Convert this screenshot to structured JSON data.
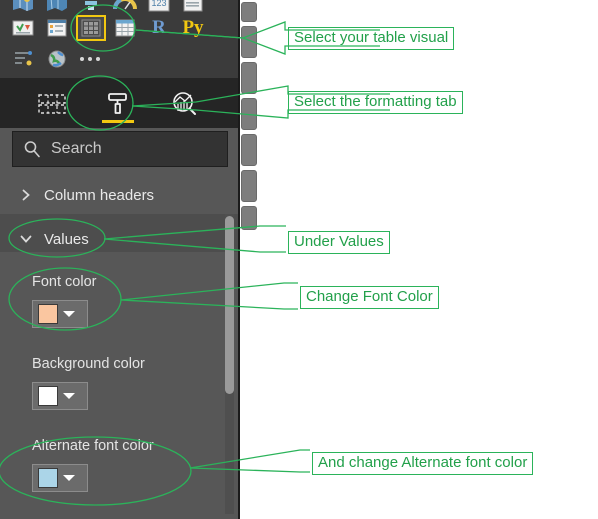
{
  "pane": {
    "visual_gallery": {
      "name": "visualizations-gallery",
      "row0": [
        {
          "icon": "map-filled-icon",
          "label": "Filled map"
        },
        {
          "icon": "globe-map-icon",
          "label": "Map"
        },
        {
          "icon": "funnel-icon",
          "label": "Funnel"
        },
        {
          "icon": "gauge-icon",
          "label": "Gauge"
        },
        {
          "icon": "card-number-icon",
          "label": "Card"
        },
        {
          "icon": "multi-row-card-icon",
          "label": "Multi-row card"
        }
      ],
      "row1": [
        {
          "icon": "kpi-icon",
          "label": "KPI"
        },
        {
          "icon": "slicer-icon",
          "label": "Slicer"
        },
        {
          "icon": "table-icon",
          "label": "Table",
          "selected": true
        },
        {
          "icon": "matrix-icon",
          "label": "Matrix"
        },
        {
          "icon": "r-script-icon",
          "label": "R"
        },
        {
          "icon": "python-script-icon",
          "label": "Py"
        }
      ],
      "row1_text": {
        "r": "R",
        "py": "Py"
      },
      "row2": [
        {
          "icon": "key-influencers-icon",
          "label": "Key influencers"
        },
        {
          "icon": "arcgis-map-icon",
          "label": "ArcGIS Maps"
        },
        {
          "icon": "more-options-icon",
          "label": "More options"
        }
      ]
    },
    "tabs": [
      {
        "id": "fields",
        "icon": "fields-table-icon",
        "label": "Fields",
        "selected": false
      },
      {
        "id": "format",
        "icon": "paint-roller-icon",
        "label": "Format",
        "selected": true
      },
      {
        "id": "analytics",
        "icon": "analytics-magnifier-icon",
        "label": "Analytics",
        "selected": false
      }
    ],
    "search": {
      "icon": "search-icon",
      "placeholder": "Search",
      "value": ""
    },
    "sections": [
      {
        "id": "column-headers",
        "label": "Column headers",
        "expanded": false,
        "chevron": "chevron-right-icon"
      },
      {
        "id": "values",
        "label": "Values",
        "expanded": true,
        "chevron": "chevron-down-icon"
      }
    ],
    "properties": [
      {
        "id": "font-color",
        "label": "Font color",
        "swatch_color": "#FAC6A0",
        "caret": "chevron-down-icon"
      },
      {
        "id": "background-color",
        "label": "Background color",
        "swatch_color": "#FFFFFF",
        "caret": "chevron-down-icon"
      },
      {
        "id": "alternate-font-color",
        "label": "Alternate font color",
        "swatch_color": "#ABD5E8",
        "caret": "chevron-down-icon"
      }
    ],
    "scrollbar": {
      "name": "format-pane-scrollbar"
    }
  },
  "annotations": {
    "accent_color": "#2BB35A",
    "items": [
      {
        "id": "a1",
        "text": "Select your table visual"
      },
      {
        "id": "a2",
        "text": "Select the formatting tab"
      },
      {
        "id": "a3",
        "text": "Under Values"
      },
      {
        "id": "a4",
        "text": "Change Font Color"
      },
      {
        "id": "a5",
        "text": "And change Alternate font color"
      }
    ]
  }
}
